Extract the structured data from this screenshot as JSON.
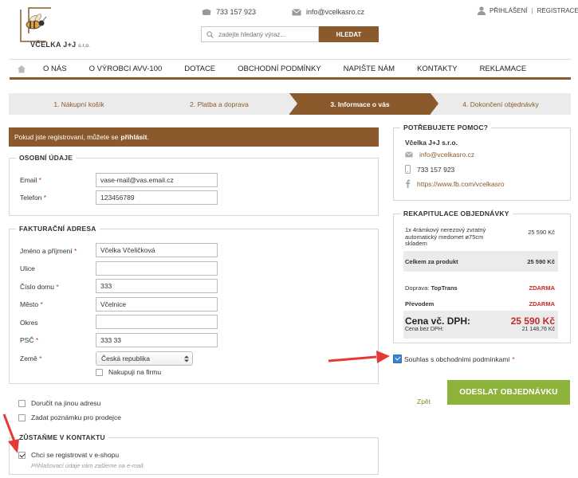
{
  "brand": {
    "name": "VČELKA J+J",
    "suffix": "s.r.o."
  },
  "header": {
    "phone": "733 157 923",
    "email": "info@vcelkasro.cz",
    "login": "PŘIHLÁŠENÍ",
    "register": "REGISTRACE",
    "search_placeholder": "zadejte hledaný výraz...",
    "search_button": "HLEDAT"
  },
  "nav": [
    "O NÁS",
    "O VÝROBCI AVV-100",
    "DOTACE",
    "OBCHODNÍ PODMÍNKY",
    "NAPIŠTE NÁM",
    "KONTAKTY",
    "REKLAMACE"
  ],
  "steps": [
    {
      "label": "1. Nákupní košík",
      "active": false
    },
    {
      "label": "2. Platba a doprava",
      "active": false
    },
    {
      "label": "3. Informace o vás",
      "active": true
    },
    {
      "label": "4. Dokončení objednávky",
      "active": false
    }
  ],
  "notice": {
    "text": "Pokud jste registrovaní, můžete se",
    "link": "přihlásit",
    "end": "."
  },
  "personal": {
    "title": "OSOBNÍ ÚDAJE",
    "email_label": "Email",
    "email_value": "vase-mail@vas.email.cz",
    "phone_label": "Telefon",
    "phone_value": "123456789"
  },
  "billing": {
    "title": "FAKTURAČNÍ ADRESA",
    "name_label": "Jméno a příjmení",
    "name_value": "Včelka Včeličková",
    "street_label": "Ulice",
    "street_value": "",
    "house_label": "Číslo domu",
    "house_value": "333",
    "city_label": "Město",
    "city_value": "Včelnice",
    "district_label": "Okres",
    "district_value": "",
    "zip_label": "PSČ",
    "zip_value": "333 33",
    "country_label": "Země",
    "country_value": "Česká republika",
    "company_label": "Nakupuji na firmu"
  },
  "options": {
    "other_address": "Doručit na jinou adresu",
    "seller_note": "Zadat poznámku pro prodejce"
  },
  "contact": {
    "title": "ZŮSTAŇME V KONTAKTU",
    "register_label": "Chci se registrovat v e-shopu",
    "register_hint": "Přihlašovací údaje vám zašleme na e-mail."
  },
  "help": {
    "title": "POTŘEBUJETE POMOC?",
    "company": "Včelka J+J s.r.o.",
    "email": "info@vcelkasro.cz",
    "phone": "733 157 923",
    "facebook": "https://www.fb.com/vcelkasro"
  },
  "summary": {
    "title": "REKAPITULACE OBJEDNÁVKY",
    "item_line1": "1x 4rámkový nerezový zvratný",
    "item_line2": "automatický medomet ø75cm",
    "item_line3": "skladem",
    "item_price": "25 590 Kč",
    "product_total_label": "Celkem za produkt",
    "product_total_value": "25 590 Kč",
    "shipping_label": "Doprava:",
    "shipping_name": "TopTrans",
    "shipping_value": "ZDARMA",
    "payment_label": "Převodem",
    "payment_value": "ZDARMA",
    "total_label": "Cena vč. DPH:",
    "total_value": "25 590 Kč",
    "net_label": "Cena bez DPH:",
    "net_value": "21 148,76 Kč"
  },
  "terms_label": "Souhlas s obchodními podmínkami",
  "back_label": "Zpět",
  "submit_label": "ODESLAT OBJEDNÁVKU",
  "colors": {
    "brand": "#8a5a2c",
    "submit": "#8db33a",
    "price": "#c62828",
    "arrow": "#e53935"
  }
}
